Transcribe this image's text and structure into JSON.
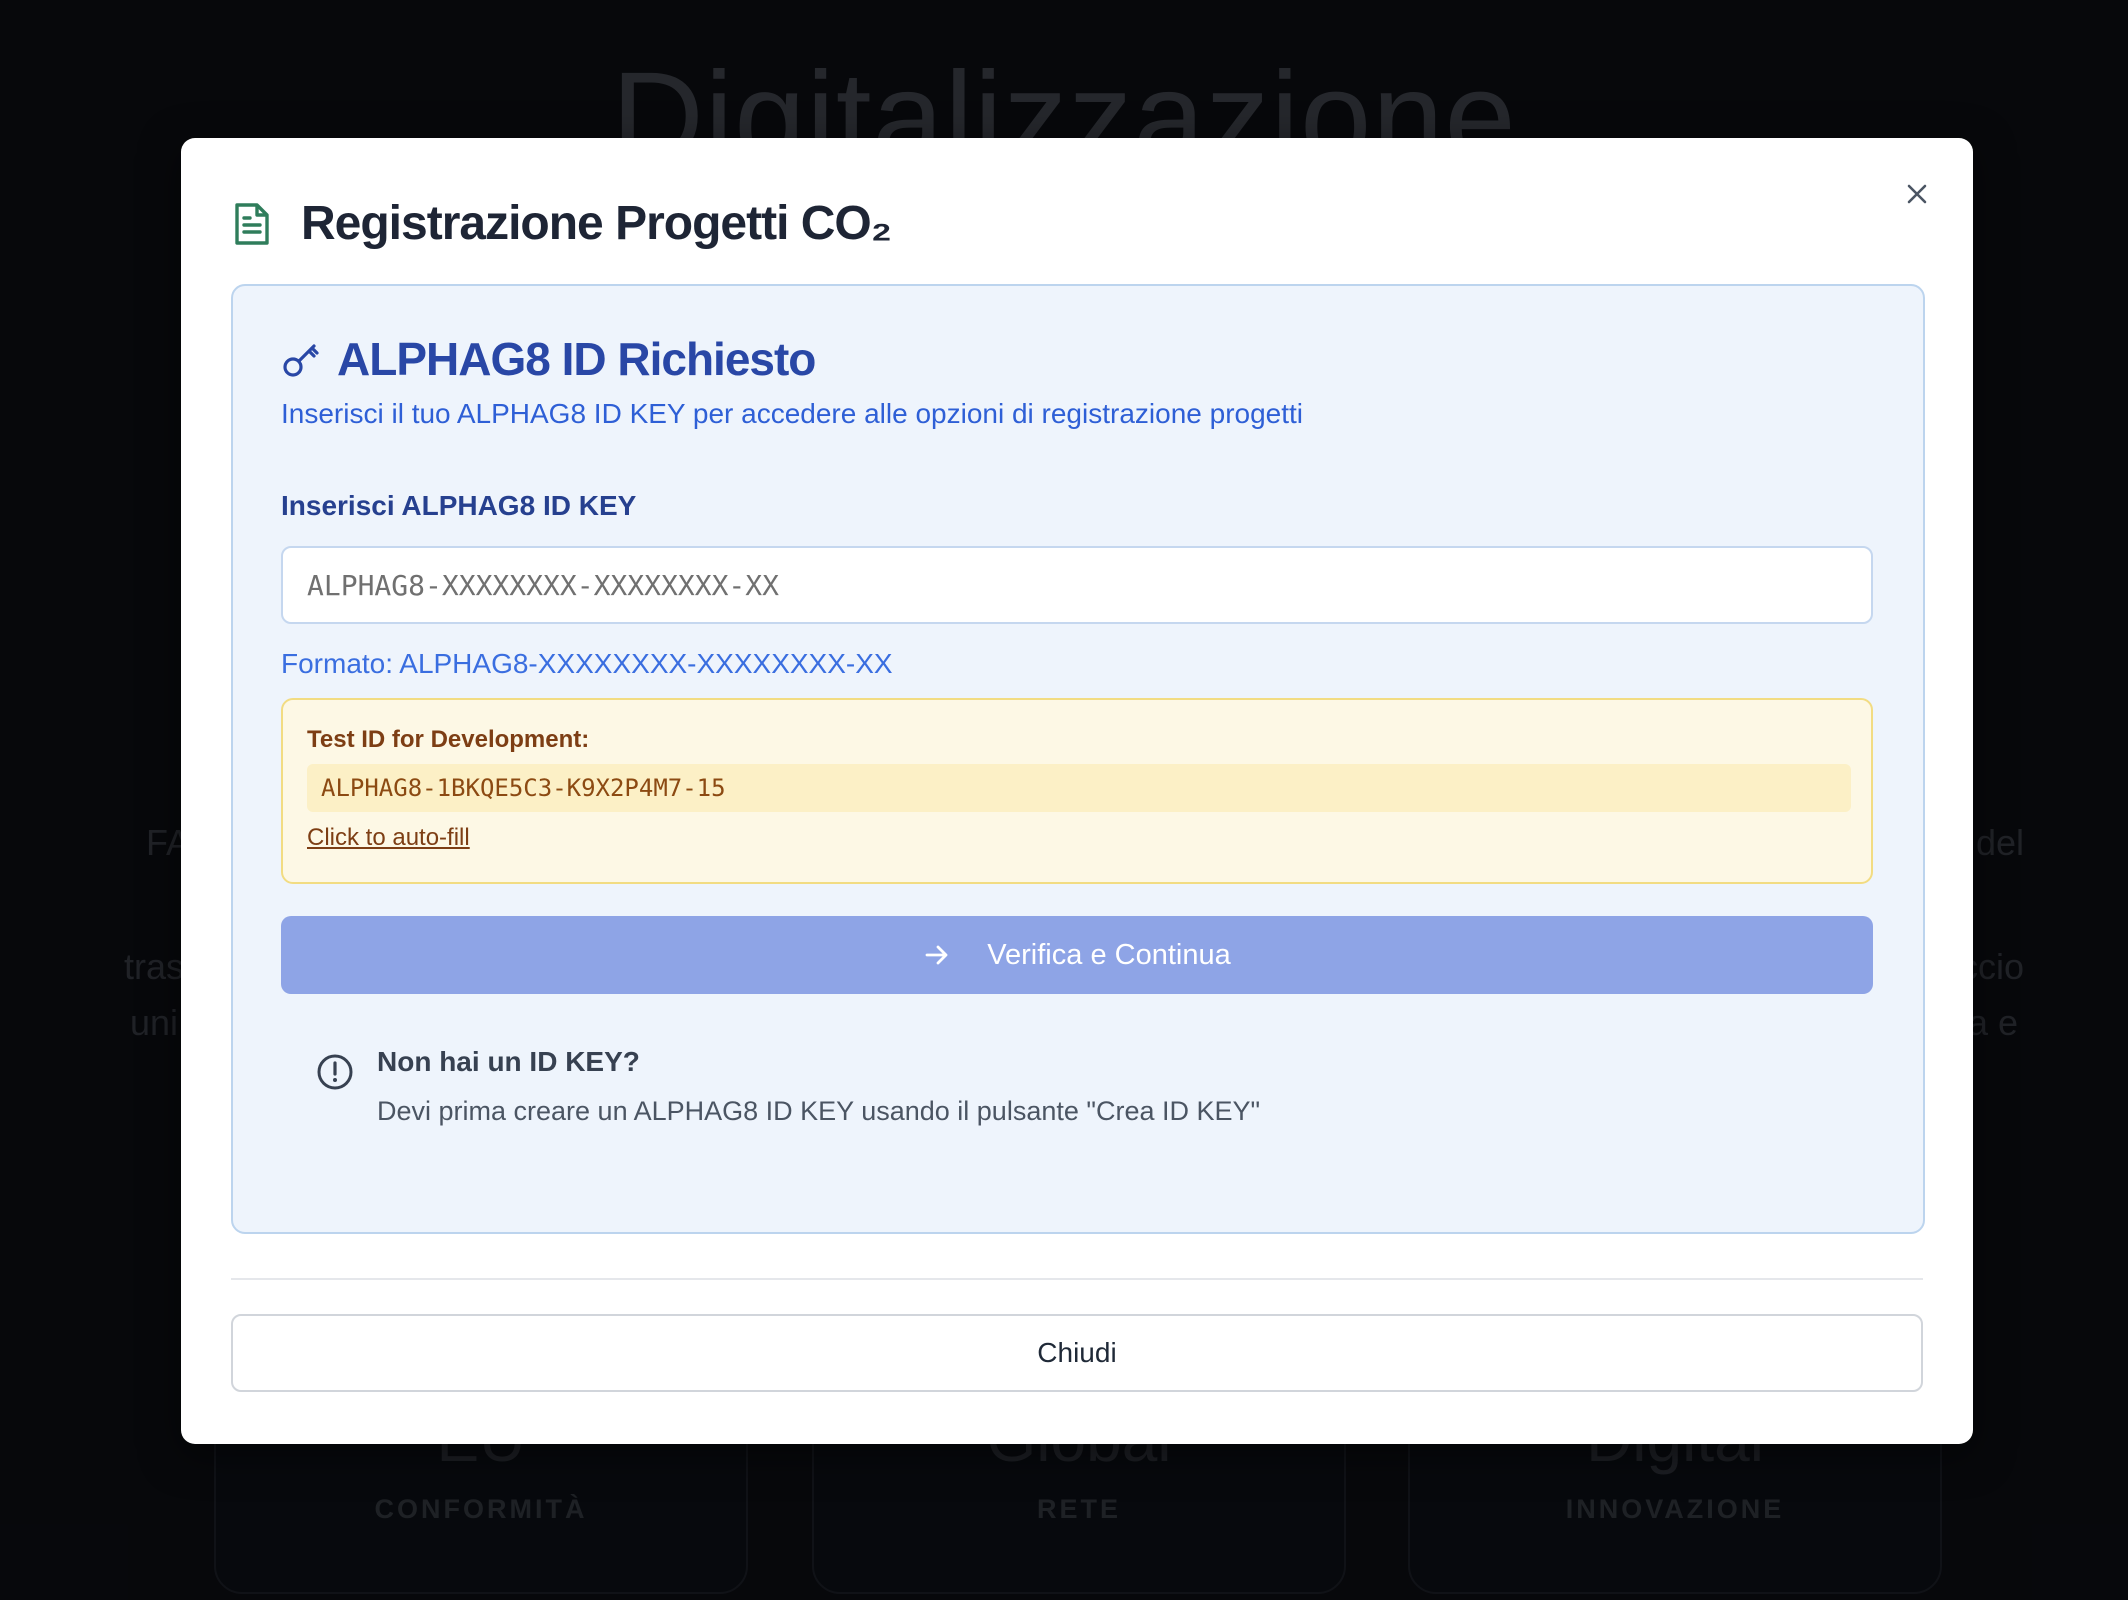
{
  "background": {
    "title": "Digitalizzazione",
    "side_fragments": [
      "FA",
      "tras",
      "uni",
      "del",
      "ccio",
      "a e"
    ],
    "cards": [
      {
        "value": "EU",
        "label": "CONFORMITÀ"
      },
      {
        "value": "Global",
        "label": "RETE"
      },
      {
        "value": "Digital",
        "label": "INNOVAZIONE"
      }
    ]
  },
  "modal": {
    "title": "Registrazione Progetti CO₂",
    "header_icon": "document-icon",
    "close_icon": "close-icon",
    "panel": {
      "icon": "key-icon",
      "title": "ALPHAG8 ID Richiesto",
      "subtitle": "Inserisci il tuo ALPHAG8 ID KEY per accedere alle opzioni di registrazione progetti",
      "field_label": "Inserisci ALPHAG8 ID KEY",
      "input_value": "",
      "input_placeholder": "ALPHAG8-XXXXXXXX-XXXXXXXX-XX",
      "format_hint": "Formato: ALPHAG8-XXXXXXXX-XXXXXXXX-XX",
      "dev": {
        "label": "Test ID for Development:",
        "code": "ALPHAG8-1BKQE5C3-K9X2P4M7-15",
        "autofill_link": "Click to auto-fill"
      },
      "verify_button": "Verifica e Continua",
      "verify_icon": "arrow-right-icon",
      "info": {
        "icon": "alert-circle-icon",
        "title": "Non hai un ID KEY?",
        "description": "Devi prima creare un ALPHAG8 ID KEY usando il pulsante \"Crea ID KEY\""
      }
    },
    "footer_button": "Chiudi"
  },
  "colors": {
    "accent_blue": "#2947a6",
    "button_blue": "#8ea4e6",
    "panel_bg": "#eef4fc",
    "dev_bg": "#fdf8e5",
    "document_icon": "#2f7d5b"
  }
}
